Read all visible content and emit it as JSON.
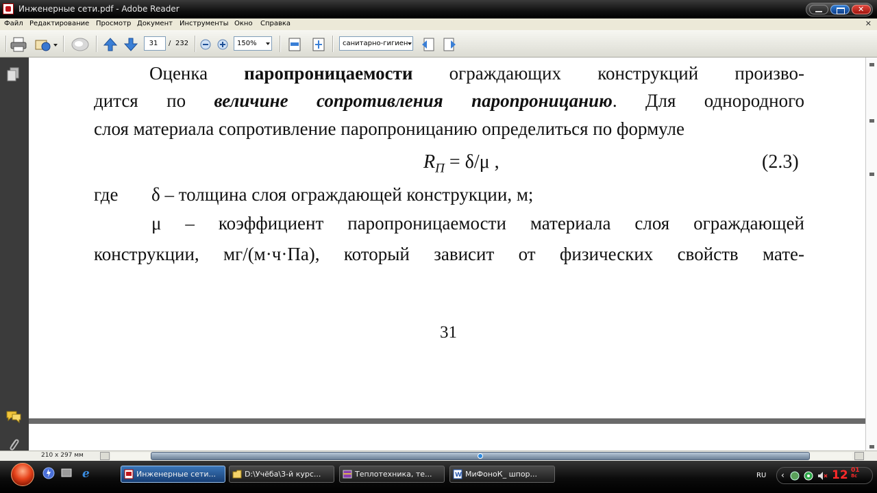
{
  "window": {
    "title": "Инженерные сети.pdf - Adobe Reader"
  },
  "menu": [
    "Файл",
    "Редактирование",
    "Просмотр",
    "Документ",
    "Инструменты",
    "Окно",
    "Справка"
  ],
  "toolbar": {
    "page_current": "31",
    "page_sep": "/",
    "page_total": "232",
    "zoom": "150%",
    "search_text": "санитарно-гигиен"
  },
  "document": {
    "line1_a": "Оценка ",
    "line1_b": "паропроницаемости",
    "line1_c": " ограждающих конструкций произво-",
    "line2_a": "дится по ",
    "line2_b": "величине сопротивления паропроницанию",
    "line2_c": ". Для однородного",
    "line3": "слоя материала сопротивление паропроницанию определиться по формуле",
    "formula_R": "R",
    "formula_sub": "П",
    "formula_rest": " = δ/μ ,",
    "formula_num": "(2.3)",
    "line5_a": "где",
    "line5_b": "δ – толщина слоя ограждающей конструкции, м;",
    "line6": "μ  – коэффициент паропроницаемости материала слоя ограждающей",
    "line7": "конструкции, мг/(м·ч·Па), который зависит от физических свойств мате-",
    "page_number": "31"
  },
  "status": {
    "page_size": "210 x 297 мм"
  },
  "taskbar": {
    "tasks": [
      "Инженерные сети...",
      "D:\\Учёба\\3-й курс...",
      "Теплотехника, те...",
      "МиФоноК_ шпор..."
    ],
    "lang": "RU",
    "clock_time": "12",
    "clock_minutes": "01",
    "clock_sec": "8с"
  },
  "colors": {
    "accent_red": "#c0141a",
    "clock": "#ff2a2a",
    "task_active": "#3a75b8"
  }
}
